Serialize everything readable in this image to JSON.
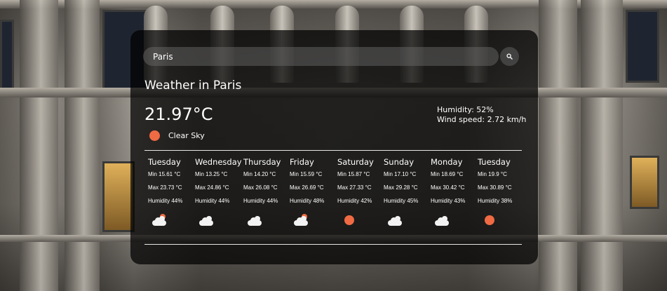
{
  "search": {
    "value": "Paris",
    "button_icon": "search-icon"
  },
  "current": {
    "title": "Weather in Paris",
    "temperature": "21.97°C",
    "description": "Clear Sky",
    "description_icon": "sun-icon",
    "humidity": "Humidity: 52%",
    "wind": "Wind speed: 2.72 km/h"
  },
  "colors": {
    "accent": "#f06a43",
    "card_bg": "rgba(0,0,0,0.72)"
  },
  "forecast": [
    {
      "day": "Tuesday",
      "min": "Min 15.61 °C",
      "max": "Max 23.73 °C",
      "humidity": "Humidity 44%",
      "icon": "partly-cloudy-icon"
    },
    {
      "day": "Wednesday",
      "min": "Min 13.25 °C",
      "max": "Max 24.86 °C",
      "humidity": "Humidity 44%",
      "icon": "cloud-icon"
    },
    {
      "day": "Thursday",
      "min": "Min 14.20 °C",
      "max": "Max 26.08 °C",
      "humidity": "Humidity 44%",
      "icon": "cloud-icon"
    },
    {
      "day": "Friday",
      "min": "Min 15.59 °C",
      "max": "Max 26.69 °C",
      "humidity": "Humidity 48%",
      "icon": "partly-cloudy-icon"
    },
    {
      "day": "Saturday",
      "min": "Min 15.87 °C",
      "max": "Max 27.33 °C",
      "humidity": "Humidity 42%",
      "icon": "sun-icon"
    },
    {
      "day": "Sunday",
      "min": "Min 17.10 °C",
      "max": "Max 29.28 °C",
      "humidity": "Humidity 45%",
      "icon": "cloud-icon"
    },
    {
      "day": "Monday",
      "min": "Min 18.69 °C",
      "max": "Max 30.42 °C",
      "humidity": "Humidity 43%",
      "icon": "cloud-icon"
    },
    {
      "day": "Tuesday",
      "min": "Min 19.9 °C",
      "max": "Max 30.89 °C",
      "humidity": "Humidity 38%",
      "icon": "sun-icon"
    }
  ]
}
